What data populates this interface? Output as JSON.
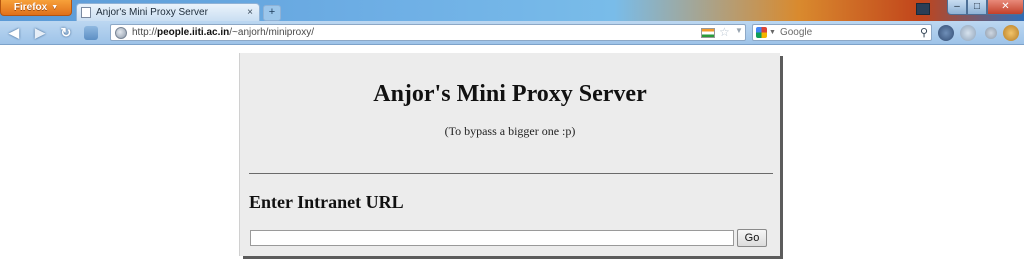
{
  "browser": {
    "menu_button_label": "Firefox",
    "tab": {
      "title": "Anjor's Mini Proxy Server",
      "close_symbol": "×"
    },
    "new_tab_symbol": "+",
    "window_controls": {
      "minimize": "–",
      "maximize": "□",
      "close": "✕"
    },
    "address": {
      "prefix": "http://",
      "domain": "people.iiti.ac.in",
      "path": "/~anjorh/miniproxy/"
    },
    "search": {
      "placeholder": "Google",
      "engine_icon": "google-icon"
    },
    "nav": {
      "back": "◀",
      "forward": "▶",
      "reload": "↻",
      "rss": "RSS"
    }
  },
  "page": {
    "title": "Anjor's Mini Proxy Server",
    "subtitle": "(To bypass a bigger one :p)",
    "section_heading": "Enter Intranet URL",
    "form": {
      "url_value": "",
      "go_label": "Go"
    }
  },
  "colors": {
    "page_box_background": "#ececec",
    "firefox_button": "#e0701a",
    "navbar": "#9ec3e8"
  }
}
